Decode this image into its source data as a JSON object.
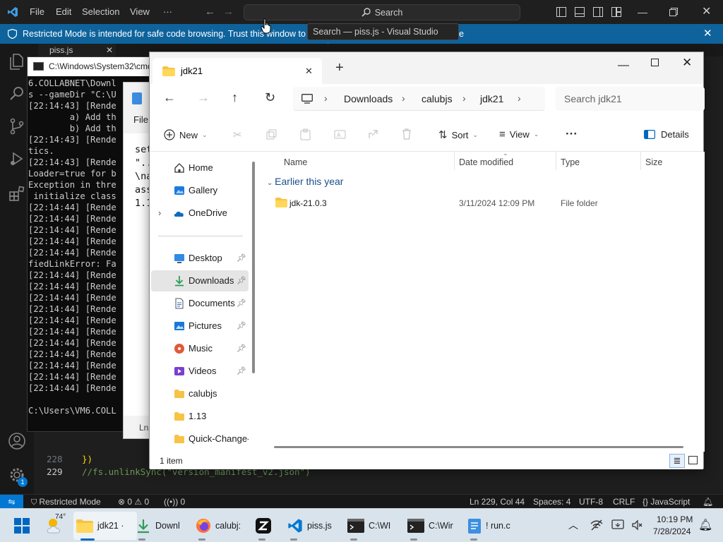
{
  "vscode": {
    "menu": [
      "File",
      "Edit",
      "Selection",
      "View",
      "···"
    ],
    "search_label": "Search",
    "tooltip": "Search — piss.js - Visual Studio Code",
    "banner": "Restricted Mode is intended for safe code browsing. Trust this window to en",
    "banner_tail": "e",
    "tab_label": "piss.js",
    "code_lines": [
      {
        "num": "228",
        "text": "})"
      },
      {
        "num": "229",
        "text": "//fs.unlinkSync(\"version_manifest_v2.json\")"
      }
    ],
    "accounts_badge": "1",
    "status": {
      "restricted": "Restricted Mode",
      "problems_errors": "0",
      "problems_warnings": "0",
      "ports": "0",
      "position": "Ln 229, Col 44",
      "spaces": "Spaces: 4",
      "encoding": "UTF-8",
      "eol": "CRLF",
      "language": "JavaScript"
    }
  },
  "cmd": {
    "title": "C:\\Windows\\System32\\cmd",
    "lines": [
      "6.COLLABNET\\Downl",
      "s --gameDir \"C:\\U",
      "[22:14:43] [Rende",
      "        a) Add th",
      "        b) Add th",
      "[22:14:43] [Rende",
      "tics.",
      "[22:14:43] [Rende",
      "Loader=true for b",
      "Exception in thre",
      " initialize class",
      "[22:14:44] [Rende",
      "[22:14:44] [Rende",
      "[22:14:44] [Rende",
      "[22:14:44] [Rende",
      "[22:14:44] [Rende",
      "fiedLinkError: Fa",
      "[22:14:44] [Rende",
      "[22:14:44] [Rende",
      "[22:14:44] [Rende",
      "[22:14:44] [Rende",
      "[22:14:44] [Rende",
      "[22:14:44] [Rende",
      "[22:14:44] [Rende",
      "[22:14:44] [Rende",
      "[22:14:44] [Rende",
      "[22:14:44] [Rende",
      "[22:14:44] [Rende",
      "",
      "C:\\Users\\VM6.COLL"
    ]
  },
  "notepad": {
    "menu_label": "File",
    "lines": [
      "set",
      "\"..",
      "\\na",
      "ass",
      "1.1"
    ],
    "status": "Ln"
  },
  "explorer": {
    "tab_title": "jdk21",
    "breadcrumb": [
      "Downloads",
      "calubjs",
      "jdk21"
    ],
    "search_placeholder": "Search jdk21",
    "toolbar": {
      "new": "New",
      "sort": "Sort",
      "view": "View",
      "more": "···",
      "details": "Details"
    },
    "sidebar": [
      {
        "label": "Home",
        "icon": "home-icon"
      },
      {
        "label": "Gallery",
        "icon": "gallery-icon"
      },
      {
        "label": "OneDrive",
        "icon": "onedrive-icon"
      },
      {
        "label": "Desktop",
        "icon": "desktop-icon",
        "pinned": true
      },
      {
        "label": "Downloads",
        "icon": "download-icon",
        "pinned": true,
        "selected": true
      },
      {
        "label": "Documents",
        "icon": "documents-icon",
        "pinned": true
      },
      {
        "label": "Pictures",
        "icon": "pictures-icon",
        "pinned": true
      },
      {
        "label": "Music",
        "icon": "music-icon",
        "pinned": true
      },
      {
        "label": "Videos",
        "icon": "videos-icon",
        "pinned": true
      },
      {
        "label": "calubjs",
        "icon": "folder-icon"
      },
      {
        "label": "1.13",
        "icon": "folder-icon"
      },
      {
        "label": "Quick-Change-I",
        "icon": "folder-icon"
      }
    ],
    "columns": [
      "Name",
      "Date modified",
      "Type",
      "Size"
    ],
    "group": "Earlier this year",
    "rows": [
      {
        "name": "jdk-21.0.3",
        "date": "3/11/2024 12:09 PM",
        "type": "File folder",
        "size": ""
      }
    ],
    "status": "1 item"
  },
  "taskbar": {
    "weather_temp": "74°",
    "apps": [
      {
        "label": "jdk21 ·",
        "icon": "folder-icon"
      },
      {
        "label": "Downl",
        "icon": "download-icon"
      },
      {
        "label": "calubj:",
        "icon": "firefox-icon"
      },
      {
        "label": "",
        "icon": "z-app-icon"
      },
      {
        "label": "piss.js",
        "icon": "vscode-icon"
      },
      {
        "label": "C:\\WI",
        "icon": "cmd-icon"
      },
      {
        "label": "C:\\Wir",
        "icon": "cmd-icon"
      },
      {
        "label": "! run.c",
        "icon": "notepad-icon"
      }
    ],
    "time": "10:19 PM",
    "date": "7/28/2024"
  }
}
